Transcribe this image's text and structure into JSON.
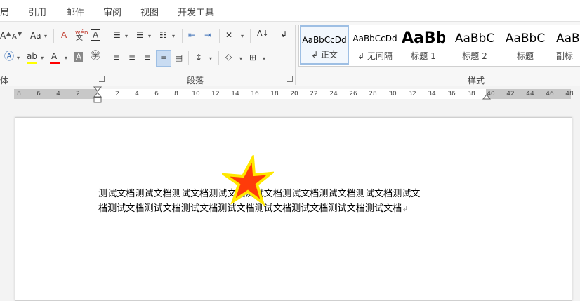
{
  "menu": {
    "tabs": [
      "局",
      "引用",
      "邮件",
      "审阅",
      "视图",
      "开发工具"
    ]
  },
  "ribbon": {
    "groups": {
      "font_tail": "体",
      "paragraph": "段落",
      "styles": "样式"
    },
    "font_change_case": "Aa",
    "pinyin_label": "wén",
    "styles_gallery": [
      {
        "sample": "AaBbCcDd",
        "name": "↲ 正文",
        "selected": true
      },
      {
        "sample": "AaBbCcDd",
        "name": "↲ 无间隔",
        "selected": false
      },
      {
        "sample": "AaBb",
        "name": "标题 1",
        "selected": false
      },
      {
        "sample": "AaBbC",
        "name": "标题 2",
        "selected": false
      },
      {
        "sample": "AaBbC",
        "name": "标题",
        "selected": false
      },
      {
        "sample": "AaB",
        "name": "副标",
        "selected": false
      }
    ],
    "colors": {
      "highlight": "#ffff00",
      "font_color": "#ff0000",
      "icon_blue": "#3b6fb6"
    }
  },
  "ruler": {
    "ticks": [
      "8",
      "6",
      "4",
      "2",
      "2",
      "4",
      "6",
      "8",
      "10",
      "12",
      "14",
      "16",
      "18",
      "20",
      "22",
      "24",
      "26",
      "28",
      "30",
      "32",
      "34",
      "36",
      "38",
      "40",
      "42",
      "44",
      "46",
      "48"
    ]
  },
  "document": {
    "line1": "测试文档测试文档测试文档测试文档测试文档测试文档测试文档测试文档测试文",
    "line2": "档测试文档测试文档测试文档测试文档测试文档测试文档测试文档测试文档",
    "paragraph_mark": "↲"
  }
}
